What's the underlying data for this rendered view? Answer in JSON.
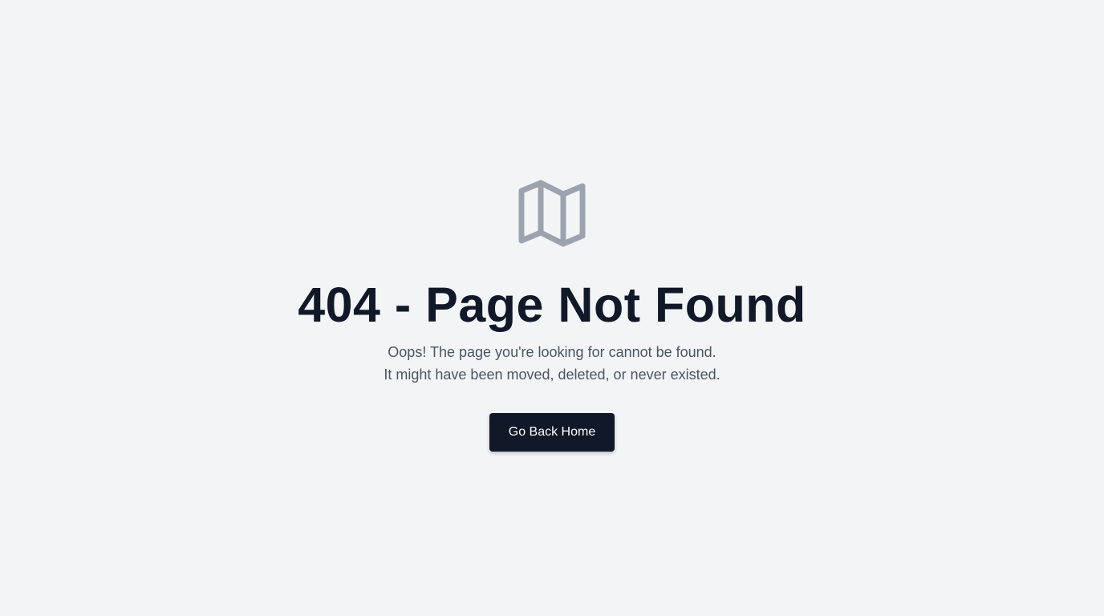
{
  "error_page": {
    "icon": "map-icon",
    "title": "404 - Page Not Found",
    "message_line_1": "Oops! The page you're looking for cannot be found.",
    "message_line_2": "It might have been moved, deleted, or never existed.",
    "button_label": "Go Back Home"
  },
  "colors": {
    "background": "#f3f4f6",
    "title": "#111827",
    "text": "#4b5563",
    "icon": "#9ca3af",
    "button_bg": "#111827",
    "button_text": "#ffffff"
  }
}
